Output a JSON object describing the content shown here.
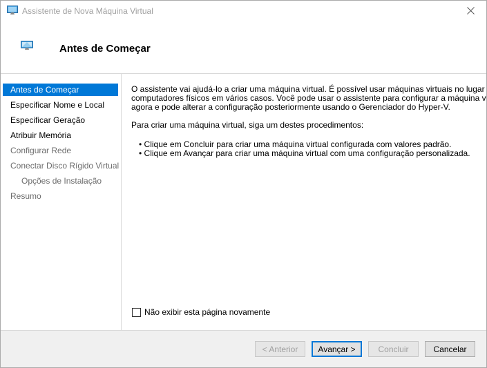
{
  "window": {
    "title": "Assistente de Nova Máquina Virtual"
  },
  "header": {
    "title": "Antes de Começar"
  },
  "nav": {
    "items": [
      {
        "label": "Antes de Começar"
      },
      {
        "label": "Especificar Nome e Local"
      },
      {
        "label": "Especificar Geração"
      },
      {
        "label": "Atribuir Memória"
      },
      {
        "label": "Configurar Rede"
      },
      {
        "label": "Conectar Disco Rígido Virtual"
      },
      {
        "label": "Opções de Instalação"
      },
      {
        "label": "Resumo"
      }
    ]
  },
  "content": {
    "para1_line1": "O assistente vai ajudá-lo a criar uma máquina virtual. É possível usar máquinas virtuais no lugar de",
    "para1_line2": "computadores físicos em vários casos. Você pode usar o assistente para configurar a máquina virtual",
    "para1_line3": "agora e pode alterar a configuração posteriormente usando o Gerenciador do Hyper-V.",
    "para2": "Para criar uma máquina virtual, siga um destes procedimentos:",
    "bullet1": "• Clique em Concluir para criar uma máquina virtual configurada com valores padrão.",
    "bullet2": "• Clique em Avançar para criar uma máquina virtual com uma configuração personalizada."
  },
  "checkbox": {
    "label": "Não exibir esta página novamente",
    "checked": false
  },
  "buttons": {
    "previous": "< Anterior",
    "next": "Avançar >",
    "finish": "Concluir",
    "cancel": "Cancelar"
  },
  "colors": {
    "selection": "#0078d7",
    "footer_bg": "#f0f0f0"
  },
  "icons": {
    "title": "virtual-machine-icon",
    "header": "virtual-machine-icon",
    "close": "close-icon"
  }
}
